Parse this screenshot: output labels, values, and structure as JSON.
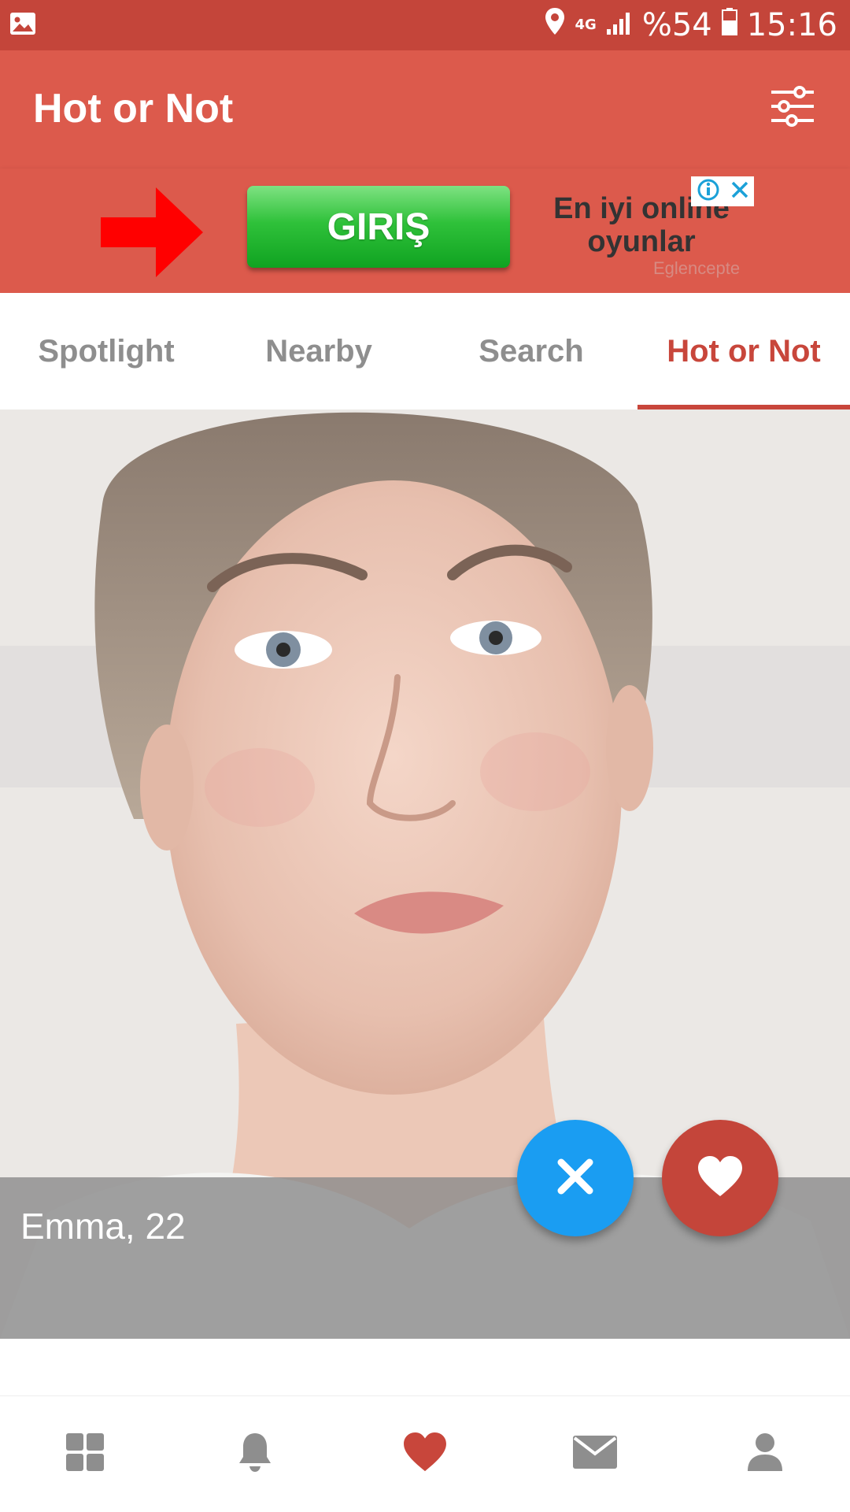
{
  "status_bar": {
    "network": "4G",
    "battery": "%54",
    "time": "15:16"
  },
  "app_bar": {
    "title": "Hot or Not",
    "filter_icon": "sliders-icon"
  },
  "ad": {
    "cta_label": "GIRIŞ",
    "headline": "En iyi online oyunlar",
    "sponsor": "Eglencepte",
    "arrow_color": "#ff0000",
    "cta_color": "#22b52f"
  },
  "tabs": [
    {
      "label": "Spotlight",
      "active": false
    },
    {
      "label": "Nearby",
      "active": false
    },
    {
      "label": "Search",
      "active": false
    },
    {
      "label": "Hot or Not",
      "active": true
    }
  ],
  "profile": {
    "name_age": "Emma, 22"
  },
  "actions": {
    "skip_icon": "close-icon",
    "like_icon": "heart-icon",
    "skip_color": "#1a9df2",
    "like_color": "#c4453a"
  },
  "bottom_nav": [
    {
      "icon": "grid-icon",
      "active": false
    },
    {
      "icon": "bell-icon",
      "active": false
    },
    {
      "icon": "heart-icon",
      "active": true
    },
    {
      "icon": "mail-icon",
      "active": false
    },
    {
      "icon": "person-icon",
      "active": false
    }
  ],
  "colors": {
    "primary": "#dc5a4c",
    "status_bar": "#c4453a",
    "accent": "#c8463b",
    "inactive": "#8e8e8e"
  }
}
